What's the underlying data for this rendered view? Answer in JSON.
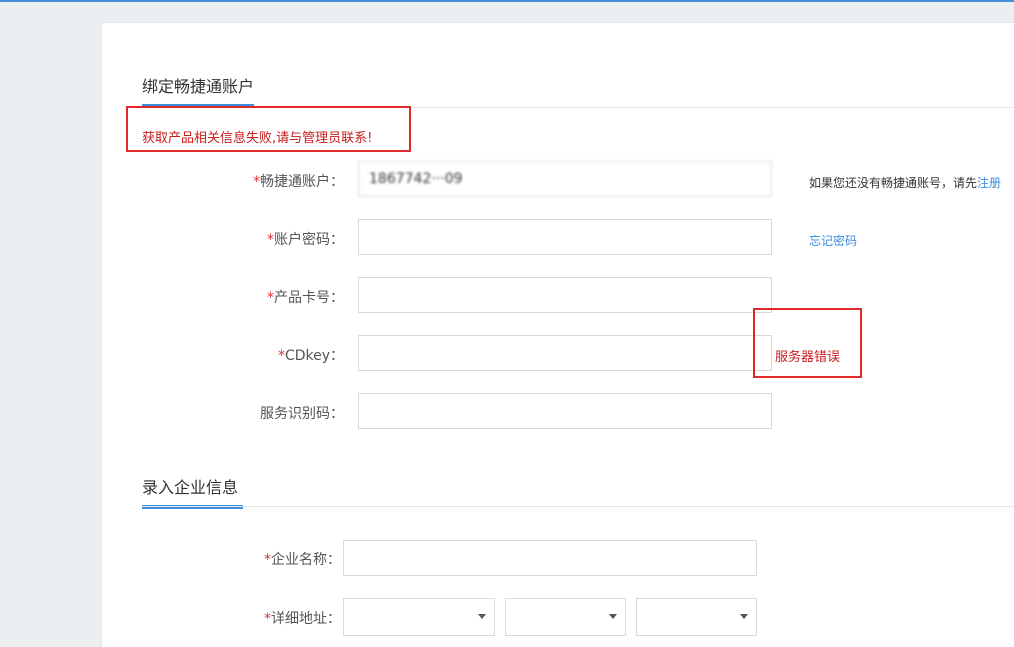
{
  "bind_section": {
    "title": "绑定畅捷通账户",
    "error_message": "获取产品相关信息失败,请与管理员联系!"
  },
  "fields": {
    "account": {
      "label": "畅捷通账户：",
      "required_mark": "*",
      "value": "1867742···09"
    },
    "password": {
      "label": "账户密码：",
      "required_mark": "*",
      "value": ""
    },
    "card_no": {
      "label": "产品卡号：",
      "required_mark": "*",
      "value": ""
    },
    "cdkey": {
      "label": "CDkey：",
      "required_mark": "*",
      "value": "",
      "error": "服务器错误"
    },
    "service_code": {
      "label": "服务识别码：",
      "value": ""
    }
  },
  "hints": {
    "no_account_text": "如果您还没有畅捷通账号，请先",
    "register_link": "注册",
    "forgot_password_link": "忘记密码"
  },
  "company_section": {
    "title": "录入企业信息",
    "name_label": "企业名称：",
    "address_label": "详细地址：",
    "required_mark": "*"
  },
  "colors": {
    "accent": "#3b8ee0",
    "error": "#c81c1c",
    "highlight_box": "#e02a2a"
  }
}
